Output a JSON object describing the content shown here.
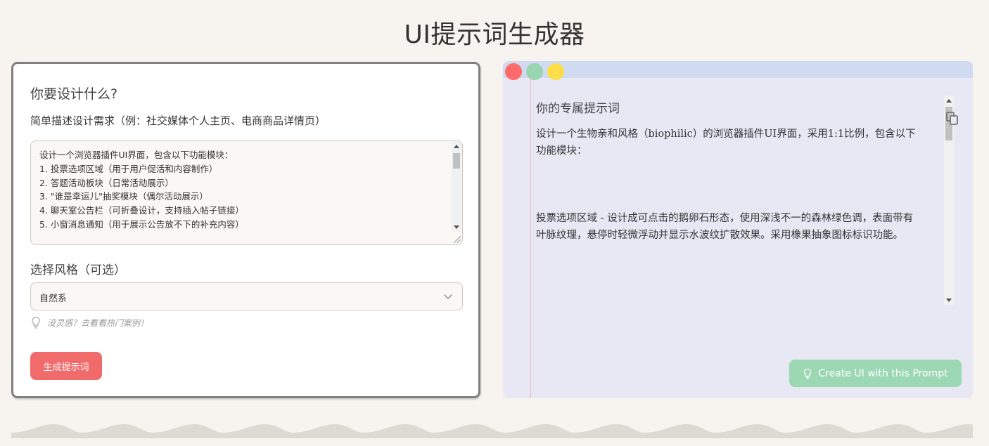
{
  "header": {
    "title": "UI提示词生成器"
  },
  "form": {
    "heading": "你要设计什么?",
    "description_label": "简单描述设计需求（例：社交媒体个人主页、电商商品详情页）",
    "textarea_lines": [
      "设计一个浏览器插件UI界面，包含以下功能模块：",
      "1. 投票选项区域（用于用户促活和内容制作）",
      "2. 答题活动板块（日常活动展示）",
      "3. \"谁是幸运儿\"抽奖模块（偶尔活动展示）",
      "4. 聊天室公告栏（可折叠设计，支持插入帖子链接）",
      "5. 小窗消息通知（用于展示公告放不下的补充内容）"
    ],
    "style_label": "选择风格（可选）",
    "style_selected": "自然系",
    "hint_text": "没灵感？去看看热门案例！",
    "generate_button": "生成提示词"
  },
  "result": {
    "title": "你的专属提示词",
    "paragraphs": [
      "设计一个生物亲和风格（biophilic）的浏览器插件UI界面，采用1:1比例，包含以下功能模块：",
      "投票选项区域 - 设计成可点击的鹅卵石形态，使用深浅不一的森林绿色调，表面带有叶脉纹理，悬停时轻微浮动并显示水波纹扩散效果。采用橡果抽象图标标识功能。"
    ],
    "create_button": "Create UI with this Prompt"
  },
  "colors": {
    "background": "#f7f4ef",
    "generate_button": "#f26b6b",
    "create_button": "#9dd8b4",
    "window_dot_red": "#ff6b6b",
    "window_dot_green": "#99d5b0",
    "window_dot_yellow": "#fddd48"
  }
}
